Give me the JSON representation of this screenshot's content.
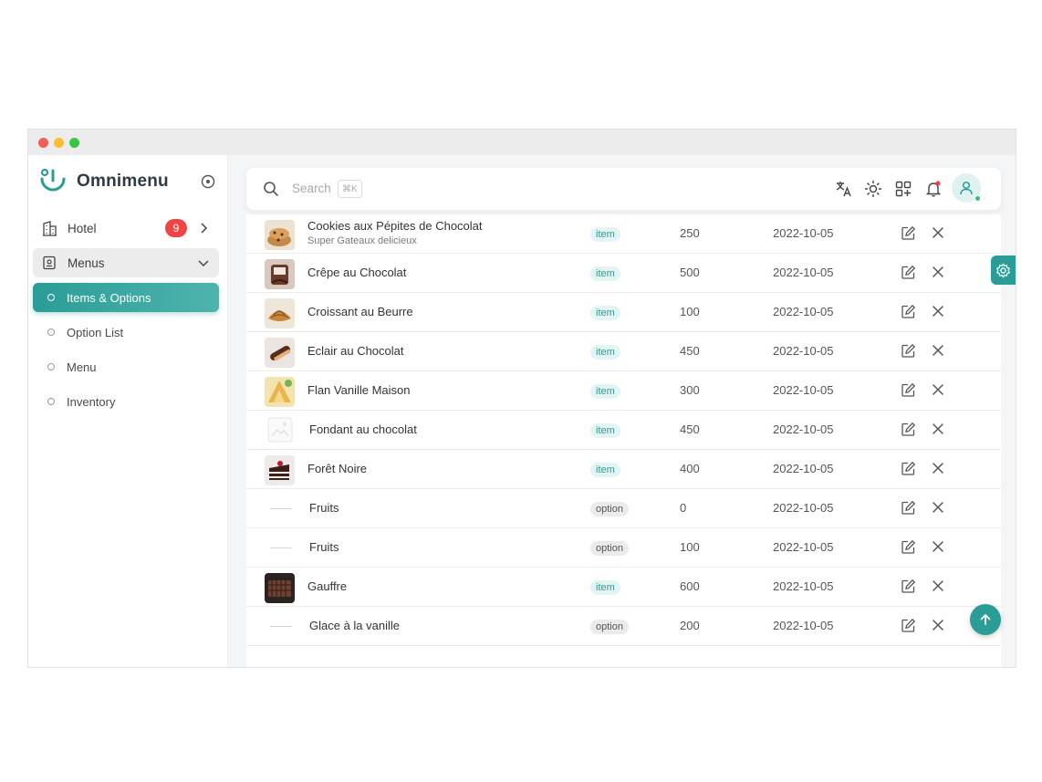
{
  "app": {
    "name": "Omnimenu"
  },
  "sidebar": {
    "hotel": {
      "label": "Hotel",
      "badge": "9"
    },
    "menus": {
      "label": "Menus"
    },
    "sub_items": [
      {
        "label": "Items & Options",
        "active": true
      },
      {
        "label": "Option List",
        "active": false
      },
      {
        "label": "Menu",
        "active": false
      },
      {
        "label": "Inventory",
        "active": false
      }
    ]
  },
  "topbar": {
    "search_placeholder": "Search",
    "shortcut": "⌘K"
  },
  "table": {
    "rows": [
      {
        "name": "Cookies aux Pépites de Chocolat",
        "subtitle": "Super Gateaux delicieux",
        "tag": "item",
        "qty": "250",
        "date": "2022-10-05",
        "thumb": "cookie"
      },
      {
        "name": "Crêpe au Chocolat",
        "subtitle": "",
        "tag": "item",
        "qty": "500",
        "date": "2022-10-05",
        "thumb": "crepe"
      },
      {
        "name": "Croissant au Beurre",
        "subtitle": "",
        "tag": "item",
        "qty": "100",
        "date": "2022-10-05",
        "thumb": "croissant"
      },
      {
        "name": "Eclair au Chocolat",
        "subtitle": "",
        "tag": "item",
        "qty": "450",
        "date": "2022-10-05",
        "thumb": "eclair"
      },
      {
        "name": "Flan Vanille Maison",
        "subtitle": "",
        "tag": "item",
        "qty": "300",
        "date": "2022-10-05",
        "thumb": "flan"
      },
      {
        "name": "Fondant au chocolat",
        "subtitle": "",
        "tag": "item",
        "qty": "450",
        "date": "2022-10-05",
        "thumb": "placeholder"
      },
      {
        "name": "Forêt Noire",
        "subtitle": "",
        "tag": "item",
        "qty": "400",
        "date": "2022-10-05",
        "thumb": "foret"
      },
      {
        "name": "Fruits",
        "subtitle": "",
        "tag": "option",
        "qty": "0",
        "date": "2022-10-05",
        "thumb": "none"
      },
      {
        "name": "Fruits",
        "subtitle": "",
        "tag": "option",
        "qty": "100",
        "date": "2022-10-05",
        "thumb": "none"
      },
      {
        "name": "Gauffre",
        "subtitle": "",
        "tag": "item",
        "qty": "600",
        "date": "2022-10-05",
        "thumb": "gauffre"
      },
      {
        "name": "Glace à la vanille",
        "subtitle": "",
        "tag": "option",
        "qty": "200",
        "date": "2022-10-05",
        "thumb": "none"
      }
    ]
  },
  "colors": {
    "accent": "#2a9d96",
    "badge": "#f04444",
    "online": "#2fbf71"
  },
  "icons": [
    "translate-icon",
    "sun-icon",
    "apps-add-icon",
    "bell-icon",
    "user-icon",
    "edit-icon",
    "close-icon",
    "settings-icon",
    "arrow-up-icon"
  ]
}
